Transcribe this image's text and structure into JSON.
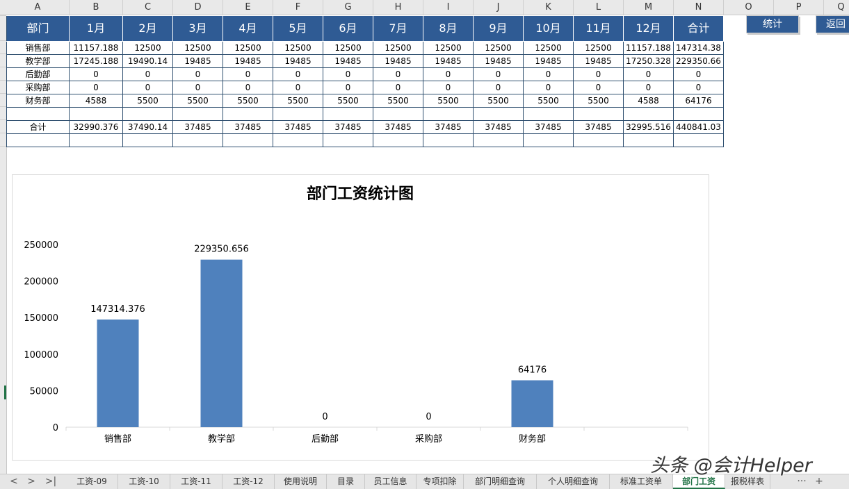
{
  "columns": [
    "A",
    "B",
    "C",
    "D",
    "E",
    "F",
    "G",
    "H",
    "I",
    "J",
    "K",
    "L",
    "M",
    "N",
    "O",
    "P",
    "Q"
  ],
  "table": {
    "header": [
      "部门",
      "1月",
      "2月",
      "3月",
      "4月",
      "5月",
      "6月",
      "7月",
      "8月",
      "9月",
      "10月",
      "11月",
      "12月",
      "合计"
    ],
    "rows": [
      [
        "销售部",
        "11157.188",
        "12500",
        "12500",
        "12500",
        "12500",
        "12500",
        "12500",
        "12500",
        "12500",
        "12500",
        "12500",
        "11157.188",
        "147314.38"
      ],
      [
        "教学部",
        "17245.188",
        "19490.14",
        "19485",
        "19485",
        "19485",
        "19485",
        "19485",
        "19485",
        "19485",
        "19485",
        "19485",
        "17250.328",
        "229350.66"
      ],
      [
        "后勤部",
        "0",
        "0",
        "0",
        "0",
        "0",
        "0",
        "0",
        "0",
        "0",
        "0",
        "0",
        "0",
        "0"
      ],
      [
        "采购部",
        "0",
        "0",
        "0",
        "0",
        "0",
        "0",
        "0",
        "0",
        "0",
        "0",
        "0",
        "0",
        "0"
      ],
      [
        "财务部",
        "4588",
        "5500",
        "5500",
        "5500",
        "5500",
        "5500",
        "5500",
        "5500",
        "5500",
        "5500",
        "5500",
        "4588",
        "64176"
      ],
      [
        "",
        "",
        "",
        "",
        "",
        "",
        "",
        "",
        "",
        "",
        "",
        "",
        "",
        ""
      ],
      [
        "合计",
        "32990.376",
        "37490.14",
        "37485",
        "37485",
        "37485",
        "37485",
        "37485",
        "37485",
        "37485",
        "37485",
        "37485",
        "32995.516",
        "440841.03"
      ],
      [
        "",
        "",
        "",
        "",
        "",
        "",
        "",
        "",
        "",
        "",
        "",
        "",
        "",
        ""
      ]
    ]
  },
  "buttons": {
    "stats": "统计",
    "back": "返回"
  },
  "chart_data": {
    "type": "bar",
    "title": "部门工资统计图",
    "categories": [
      "销售部",
      "教学部",
      "后勤部",
      "采购部",
      "财务部"
    ],
    "values": [
      147314.376,
      229350.656,
      0,
      0,
      64176
    ],
    "data_labels": [
      "147314.376",
      "229350.656",
      "0",
      "0",
      "64176"
    ],
    "ylim": [
      0,
      250000
    ],
    "yticks": [
      0,
      50000,
      100000,
      150000,
      200000,
      250000
    ],
    "bar_color": "#4f81bd",
    "grid": false,
    "legend": "none"
  },
  "tabs": [
    "工资-09",
    "工资-10",
    "工资-11",
    "工资-12",
    "使用说明",
    "目录",
    "员工信息",
    "专项扣除",
    "部门明细查询",
    "个人明细查询",
    "标准工资单",
    "部门工资",
    "报税样表"
  ],
  "active_tab": "部门工资",
  "tab_nav": {
    "prev": "<",
    "next": ">",
    "last": ">|",
    "more": "···",
    "add": "+"
  },
  "watermark": "头条 @会计Helper"
}
